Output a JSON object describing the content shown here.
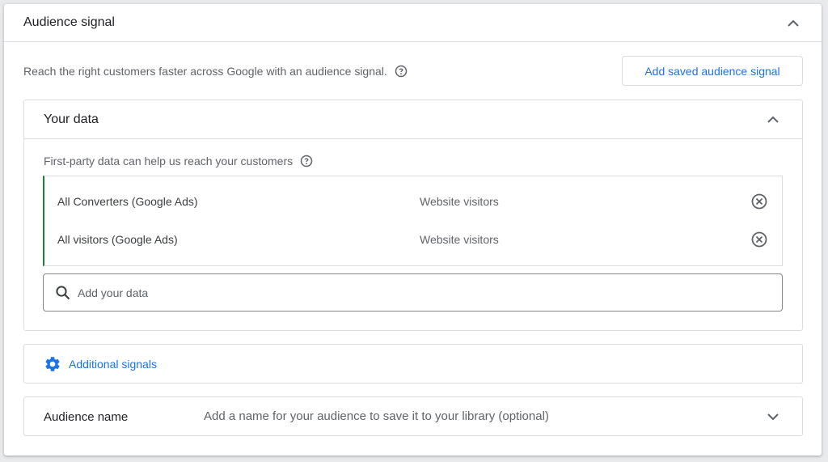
{
  "audience_signal": {
    "title": "Audience signal",
    "intro": "Reach the right customers faster across Google with an audience signal.",
    "add_saved_button": "Add saved audience signal"
  },
  "your_data": {
    "title": "Your data",
    "first_party_text": "First-party data can help us reach your customers",
    "items": [
      {
        "name": "All Converters (Google Ads)",
        "type": "Website visitors"
      },
      {
        "name": "All visitors (Google Ads)",
        "type": "Website visitors"
      }
    ],
    "search_placeholder": "Add your data"
  },
  "additional_signals": {
    "label": "Additional signals"
  },
  "audience_name": {
    "label": "Audience name",
    "hint": "Add a name for your audience to save it to your library (optional)"
  },
  "icons": {
    "collapse": "chevron-up-icon",
    "expand": "chevron-down-icon",
    "help": "help-circle-icon",
    "remove": "close-circle-icon",
    "search": "search-icon",
    "signals": "gear-icon"
  },
  "colors": {
    "accent": "#1a73e8",
    "selected_border": "#188038",
    "divider": "#dadce0"
  }
}
